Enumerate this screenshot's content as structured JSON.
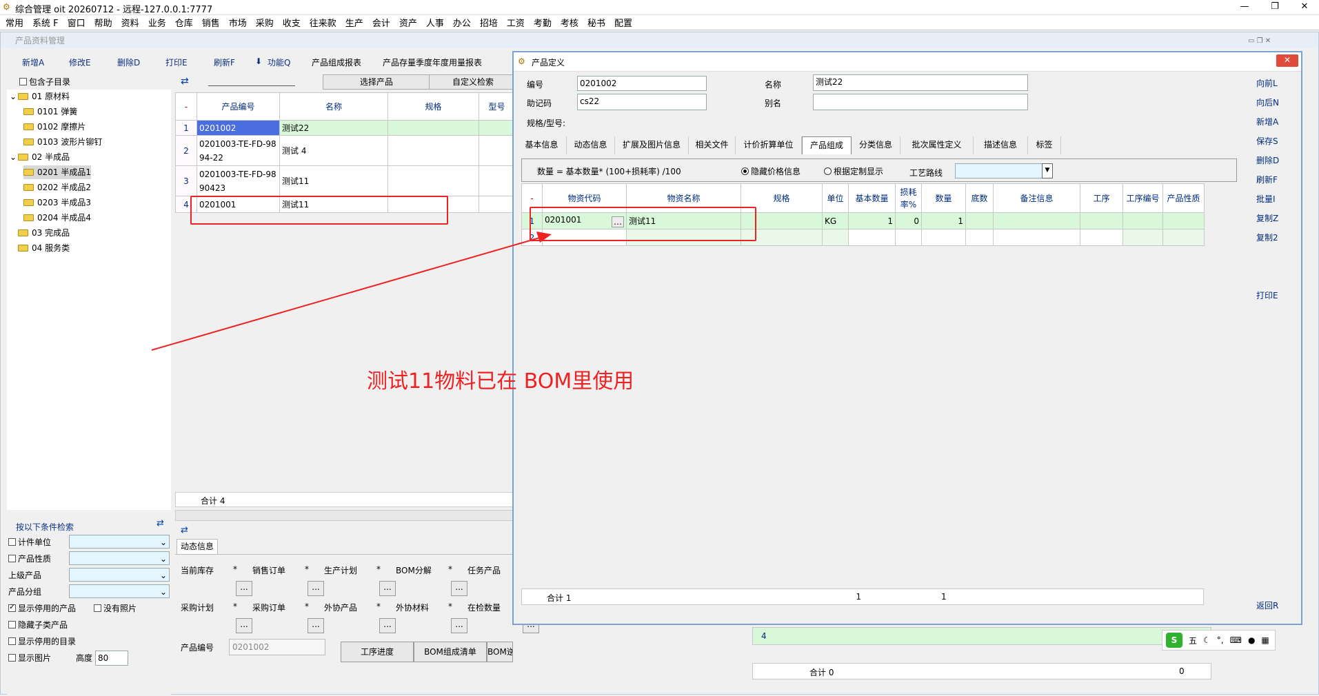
{
  "app": {
    "title": "综合管理 oit 20260712 - 远程-127.0.0.1:7777"
  },
  "menu": [
    "常用",
    "系统 F",
    "窗口",
    "帮助",
    "资料",
    "业务",
    "仓库",
    "销售",
    "市场",
    "采购",
    "收支",
    "往来款",
    "生产",
    "会计",
    "资产",
    "人事",
    "办公",
    "招培",
    "工资",
    "考勤",
    "考核",
    "秘书",
    "配置"
  ],
  "main": {
    "window_title": "产品资料管理",
    "toolbar": {
      "new": "新增A",
      "edit": "修改E",
      "delete": "删除D",
      "print": "打印E",
      "refresh": "刷新F",
      "function": "功能Q",
      "bom_report": "产品组成报表",
      "stock_report": "产品存量季度年度用量报表"
    },
    "include_sub": "包含子目录",
    "select_product": "选择产品",
    "custom_search": "自定义检索",
    "tree": [
      "01 原材料",
      "0101 弹簧",
      "0102 摩擦片",
      "0103 波形片铆钉",
      "02 半成品",
      "0201 半成品1",
      "0202 半成品2",
      "0203 半成品3",
      "0204 半成品4",
      "03 完成品",
      "04 服务类"
    ],
    "grid": {
      "headers": [
        "-",
        "产品编号",
        "名称",
        "规格",
        "型号"
      ],
      "rows": [
        [
          "1",
          "0201002",
          "测试22"
        ],
        [
          "2",
          "0201003-TE-FD-9894-22",
          "测试 4"
        ],
        [
          "3",
          "0201003-TE-FD-9890423",
          "测试11"
        ],
        [
          "4",
          "0201001",
          "测试11"
        ]
      ],
      "total": "合计 4"
    },
    "filter": {
      "title": "按以下条件检索",
      "unit": "计件单位",
      "nature": "产品性质",
      "parent": "上级产品",
      "group": "产品分组",
      "show_disabled": "显示停用的产品",
      "no_photo": "没有照片",
      "hide_sub": "隐藏子类产品",
      "show_disabled_dir": "显示停用的目录",
      "show_img": "显示图片",
      "height_label": "高度",
      "height_value": "80"
    },
    "dynamic": {
      "tab": "动态信息",
      "row1": [
        "当前库存",
        "销售订单",
        "生产计划",
        "BOM分解",
        "任务产品"
      ],
      "row2": [
        "采购计划",
        "采购订单",
        "外协产品",
        "外协材料",
        "在检数量"
      ],
      "code_label": "产品编号",
      "code_value": "0201002",
      "btn_process": "工序进度",
      "btn_bom": "BOM组成清单",
      "btn_reverse": "BOM逆向清单"
    },
    "right_grid": {
      "row4": "4",
      "total": "合计 0",
      "zero": "0"
    }
  },
  "dialog": {
    "title": "产品定义",
    "code_label": "编号",
    "code_value": "0201002",
    "name_label": "名称",
    "name_value": "测试22",
    "memo_label": "助记码",
    "memo_value": "cs22",
    "alias_label": "别名",
    "spec_label": "规格/型号:",
    "tabs": [
      "基本信息",
      "动态信息",
      "扩展及图片信息",
      "相关文件",
      "计价折算单位",
      "产品组成",
      "分类信息",
      "批次属性定义",
      "描述信息",
      "标签"
    ],
    "formula": "数量 = 基本数量* (100+损耗率) /100",
    "hide_price": "隐藏价格信息",
    "by_custom": "根据定制显示",
    "route": "工艺路线",
    "grid_headers": [
      "-",
      "物资代码",
      "物资名称",
      "规格",
      "单位",
      "基本数量",
      "损耗率%",
      "数量",
      "底数",
      "备注信息",
      "工序",
      "工序编号",
      "产品性质"
    ],
    "row1": {
      "n": "1",
      "code": "0201001",
      "name": "测试11",
      "unit": "KG",
      "base": "1",
      "loss": "0",
      "qty": "1"
    },
    "row2": "2",
    "total": {
      "label": "合计 1",
      "base": "1",
      "qty": "1"
    },
    "side": [
      "向前L",
      "向后N",
      "新增A",
      "保存S",
      "删除D",
      "刷新F",
      "批量I",
      "复制Z",
      "复制2",
      "打印E",
      "返回R"
    ]
  },
  "annotation": "测试11物料已在 BOM里使用",
  "ime": "五"
}
